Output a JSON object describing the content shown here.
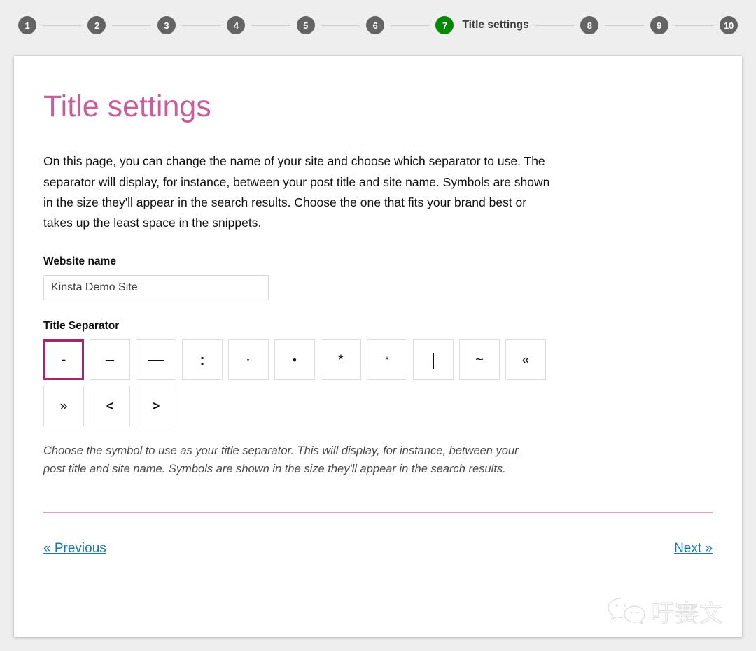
{
  "stepper": {
    "steps": [
      {
        "number": "1",
        "label": "",
        "active": false
      },
      {
        "number": "2",
        "label": "",
        "active": false
      },
      {
        "number": "3",
        "label": "",
        "active": false
      },
      {
        "number": "4",
        "label": "",
        "active": false
      },
      {
        "number": "5",
        "label": "",
        "active": false
      },
      {
        "number": "6",
        "label": "",
        "active": false
      },
      {
        "number": "7",
        "label": "Title settings",
        "active": true
      },
      {
        "number": "8",
        "label": "",
        "active": false
      },
      {
        "number": "9",
        "label": "",
        "active": false
      },
      {
        "number": "10",
        "label": "",
        "active": false
      }
    ],
    "active_color": "#008a00",
    "inactive_color": "#646464",
    "connector_color": "#cbcbcb"
  },
  "card": {
    "title": "Title settings",
    "title_color": "#c75f9b",
    "intro": "On this page, you can change the name of your site and choose which separator to use. The separator will display, for instance, between your post title and site name. Symbols are shown in the size they'll appear in the search results. Choose the one that fits your brand best or takes up the least space in the snippets.",
    "website_name": {
      "label": "Website name",
      "value": "Kinsta Demo Site",
      "placeholder": "Website name"
    },
    "separator": {
      "label": "Title Separator",
      "selected_index": 0,
      "selected_color": "#a4286a",
      "help_text": "Choose the symbol to use as your title separator. This will display, for instance, between your post title and site name. Symbols are shown in the size they'll appear in the search results.",
      "rows": [
        [
          {
            "name": "hyphen",
            "glyph": "-",
            "cls": "g-hyphen"
          },
          {
            "name": "en-dash",
            "glyph": "–",
            "cls": "g-ndash"
          },
          {
            "name": "em-dash",
            "glyph": "—",
            "cls": "g-mdash"
          },
          {
            "name": "colon",
            "glyph": ":",
            "cls": "g-colon"
          },
          {
            "name": "middle-dot",
            "glyph": "·",
            "cls": "g-middot"
          },
          {
            "name": "bullet",
            "glyph": "•",
            "cls": "g-bullet"
          },
          {
            "name": "asterisk",
            "glyph": "*",
            "cls": "g-ast"
          },
          {
            "name": "small-asterisk",
            "glyph": "*",
            "cls": "g-astsm"
          },
          {
            "name": "pipe",
            "glyph": "|",
            "cls": "g-pipe"
          },
          {
            "name": "tilde",
            "glyph": "~",
            "cls": "g-tilde"
          },
          {
            "name": "left-guillemet",
            "glyph": "«",
            "cls": "g-laquo"
          }
        ],
        [
          {
            "name": "right-guillemet",
            "glyph": "»",
            "cls": "g-raquo"
          },
          {
            "name": "less-than",
            "glyph": "<",
            "cls": "g-lt"
          },
          {
            "name": "greater-than",
            "glyph": ">",
            "cls": "g-gt"
          }
        ]
      ]
    },
    "divider_color": "#e39fc4",
    "footer": {
      "previous_label": "« Previous",
      "next_label": "Next »",
      "link_color": "#1a77b5"
    }
  },
  "watermark": {
    "text": "吁赛文",
    "icon": "wechat-icon"
  }
}
